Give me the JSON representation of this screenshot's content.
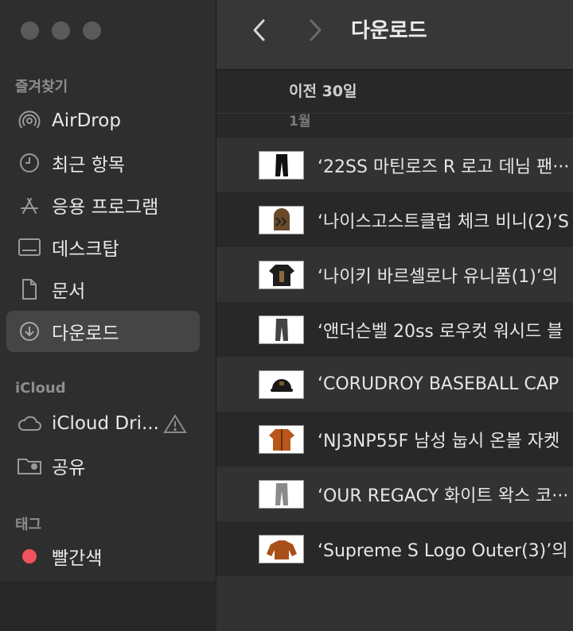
{
  "sidebar": {
    "sections": {
      "favorites": "즐겨찾기",
      "icloud": "iCloud",
      "tags": "태그"
    },
    "items": [
      {
        "label": "AirDrop",
        "icon": "airdrop-icon"
      },
      {
        "label": "최근 항목",
        "icon": "clock-icon"
      },
      {
        "label": "응용 프로그램",
        "icon": "applications-icon"
      },
      {
        "label": "데스크탑",
        "icon": "desktop-icon"
      },
      {
        "label": "문서",
        "icon": "document-icon"
      },
      {
        "label": "다운로드",
        "icon": "download-icon",
        "selected": true
      },
      {
        "label": "iCloud Dri...",
        "icon": "cloud-icon",
        "warning": true
      },
      {
        "label": "공유",
        "icon": "shared-folder-icon"
      },
      {
        "label": "빨간색",
        "icon": "red-tag-icon",
        "color": "#f2525b"
      }
    ]
  },
  "toolbar": {
    "title": "다운로드"
  },
  "list": {
    "group_header": "이전 30일",
    "group_sub": "1월",
    "files": [
      {
        "name": "‘22SS 마틴로즈 R 로고 데님 팬···"
      },
      {
        "name": "‘나이스고스트클럽 체크 비니(2)’S"
      },
      {
        "name": "‘나이키 바르셀로나 유니폼(1)’의"
      },
      {
        "name": "‘앤더슨벨 20ss 로우컷 워시드 블"
      },
      {
        "name": "‘CORUDROY BASEBALL CAP"
      },
      {
        "name": "‘NJ3NP55F 남성 눕시 온볼 자켓"
      },
      {
        "name": "‘OUR REGACY 화이트 왁스 코···"
      },
      {
        "name": "‘Supreme S Logo Outer(3)’의"
      }
    ]
  }
}
